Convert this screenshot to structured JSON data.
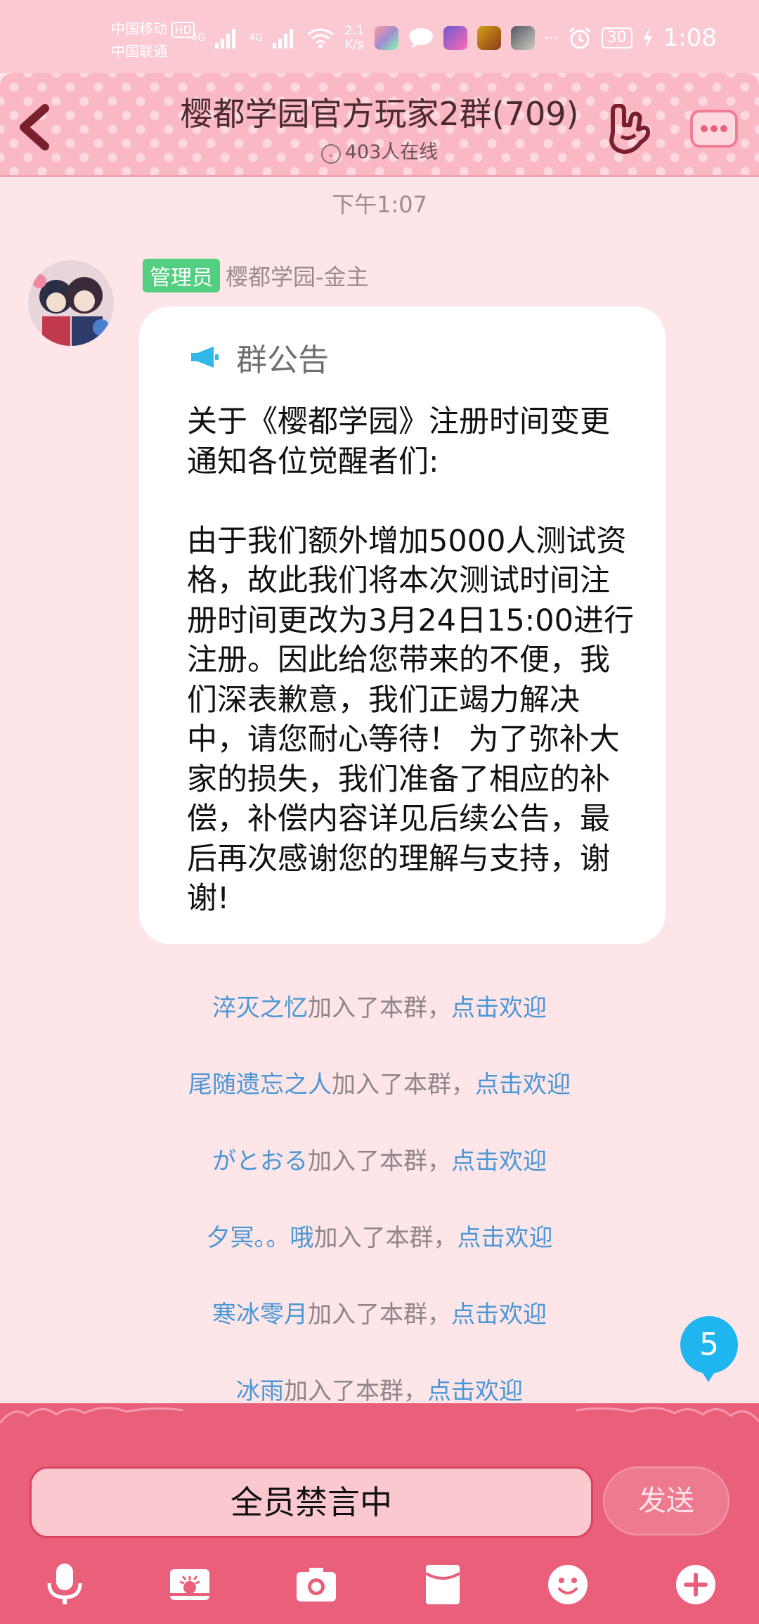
{
  "status_bar": {
    "carrier1": "中国移动",
    "carrier1_badge": "HD",
    "carrier2": "中国联通",
    "net1": "4G",
    "net2": "4G",
    "speed": "2.1",
    "speed_unit": "K/s",
    "more": "···",
    "battery": "30",
    "time": "1:08"
  },
  "header": {
    "title": "樱都学园官方玩家2群(709)",
    "online": "403人在线"
  },
  "timestamp": "下午1:07",
  "message": {
    "role_badge": "管理员",
    "sender": "樱都学园-金主",
    "notice_label": "群公告",
    "notice_text": "关于《樱都学园》注册时间变更通知各位觉醒者们:\n\n由于我们额外增加5000人测试资格，故此我们将本次测试时间注册时间更改为3月24日15:00进行注册。因此给您带来的不便，我们深表歉意，我们正竭力解决中，请您耐心等待！ 为了弥补大家的损失，我们准备了相应的补偿，补偿内容详见后续公告，最后再次感谢您的理解与支持，谢谢!"
  },
  "joins": [
    {
      "name": "淬灭之忆",
      "text": "加入了本群，",
      "link": "点击欢迎"
    },
    {
      "name": "尾随遗忘之人",
      "text": "加入了本群，",
      "link": "点击欢迎"
    },
    {
      "name": "がとおる",
      "text": "加入了本群，",
      "link": "点击欢迎"
    },
    {
      "name": "夕冥。。哦",
      "text": "加入了本群，",
      "link": "点击欢迎"
    },
    {
      "name": "寒冰零月",
      "text": "加入了本群，",
      "link": "点击欢迎"
    },
    {
      "name": "冰雨",
      "text": "加入了本群，",
      "link": "点击欢迎"
    }
  ],
  "unread_count": "5",
  "input_bar": {
    "muted_text": "全员禁言中",
    "send_label": "发送"
  },
  "toolbar_icons": [
    "microphone-icon",
    "image-icon",
    "camera-icon",
    "red-packet-icon",
    "emoji-icon",
    "plus-icon"
  ],
  "colors": {
    "header_pink": "#f9b8c4",
    "bottom_pink": "#ea5f7a",
    "link_blue": "#4a97d5",
    "admin_green": "#53cf81",
    "badge_blue": "#1fb5ef"
  }
}
